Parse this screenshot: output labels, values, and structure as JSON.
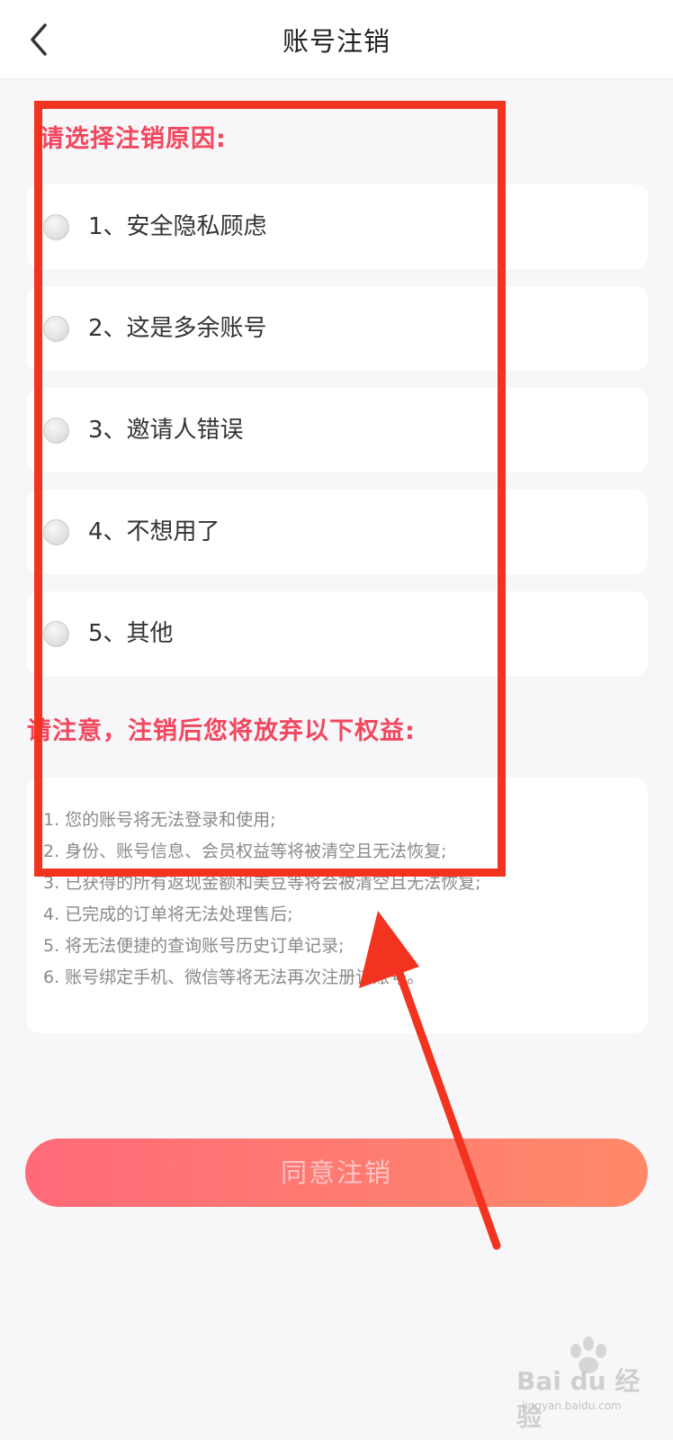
{
  "header": {
    "back_icon": "chevron-left-icon",
    "title": "账号注销"
  },
  "reasons": {
    "title": "请选择注销原因:",
    "items": [
      {
        "label": "1、安全隐私顾虑",
        "selected": false
      },
      {
        "label": "2、这是多余账号",
        "selected": false
      },
      {
        "label": "3、邀请人错误",
        "selected": false
      },
      {
        "label": "4、不想用了",
        "selected": false
      },
      {
        "label": "5、其他",
        "selected": false
      }
    ]
  },
  "notice": {
    "title": "请注意，注销后您将放弃以下权益:",
    "lines": [
      "1. 您的账号将无法登录和使用;",
      "2. 身份、账号信息、会员权益等将被清空且无法恢复;",
      "3. 已获得的所有返现金额和美豆等将会被清空且无法恢复;",
      "4. 已完成的订单将无法处理售后;",
      "5. 将无法便捷的查询账号历史订单记录;",
      "6. 账号绑定手机、微信等将无法再次注册该账号。"
    ]
  },
  "agree_button": {
    "label": "同意注销"
  },
  "watermark": {
    "brand": "Bai du 经验",
    "site": "jingyan.baidu.com"
  },
  "colors": {
    "accent_red": "#f2475e",
    "annotation_red": "#f2331f",
    "button_gradient_start": "#ff6a78",
    "button_gradient_end": "#ff8a6a"
  }
}
